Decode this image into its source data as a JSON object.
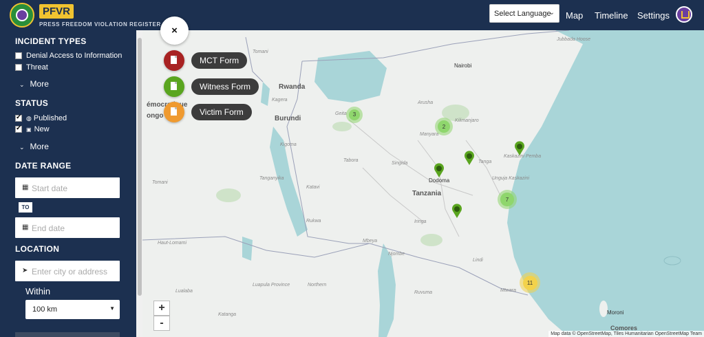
{
  "header": {
    "brand": "PFVR",
    "brand_subtitle": "PRESS FREEDOM VIOLATION REGISTER",
    "language_select": "Select Language",
    "nav": [
      "Map",
      "Timeline",
      "Settings"
    ]
  },
  "sidebar": {
    "incident_types": {
      "heading": "INCIDENT TYPES",
      "items": [
        "Denial Access to Information",
        "Threat"
      ],
      "more": "More"
    },
    "status": {
      "heading": "STATUS",
      "items": [
        "Published",
        "New"
      ],
      "more": "More"
    },
    "date_range": {
      "heading": "DATE RANGE",
      "start_placeholder": "Start date",
      "to_label": "TO",
      "end_placeholder": "End date"
    },
    "location": {
      "heading": "LOCATION",
      "placeholder": "Enter city or address",
      "within_label": "Within",
      "within_value": "100 km"
    }
  },
  "forms": {
    "close_icon": "×",
    "items": [
      {
        "label": "MCT Form",
        "color": "#a82222"
      },
      {
        "label": "Witness Form",
        "color": "#5aa51f"
      },
      {
        "label": "Victim Form",
        "color": "#ef9a30"
      }
    ]
  },
  "map": {
    "labels": {
      "rwanda": "Rwanda",
      "burundi": "Burundi",
      "tanzania": "Tanzania",
      "dodoma": "Dodoma",
      "nairobi": "Nairobi",
      "moroni": "Moroni",
      "comores": "Comores",
      "congo_a": "émocratique",
      "congo_b": "ongo",
      "kigoma": "Kigoma",
      "tabora": "Tabora",
      "katavi": "Katavi",
      "rukwa": "Rukwa",
      "mbeya": "Mbeya",
      "njombe": "Njombe",
      "iringa": "Iringa",
      "lindi": "Lindi",
      "ruvuma": "Ruvuma",
      "mtwara": "Mtwara",
      "singida": "Singida",
      "manyara": "Manyara",
      "arusha": "Arusha",
      "tanga": "Tanga",
      "tomani": "Tomani",
      "haut_lomami": "Haut-Lomami",
      "lualaba": "Lualaba",
      "luapula": "Luapula Province",
      "northern": "Northern",
      "jubbada": "Jubbada Hoose",
      "kilimanjaro": "Kilimanjaro",
      "kaskazini": "Kaskazini Pemba",
      "unguja": "Unguja Kaskazini",
      "kagera": "Kagera",
      "geita": "Geita",
      "tanganyika": "Tanganyika",
      "katanga": "Katanga"
    },
    "clusters": [
      "3",
      "2",
      "7",
      "11"
    ],
    "zoom_in": "+",
    "zoom_out": "-",
    "attribution": "Map data © OpenStreetMap, Tiles Humanitarian OpenStreetMap Team"
  },
  "colors": {
    "header_bg": "#1c3050",
    "brand_yellow": "#f0c330",
    "water": "#a9d5d8",
    "cluster_green": "#8fd66d",
    "cluster_yellow": "#f3d24b",
    "pin_green": "#5aa51f"
  }
}
